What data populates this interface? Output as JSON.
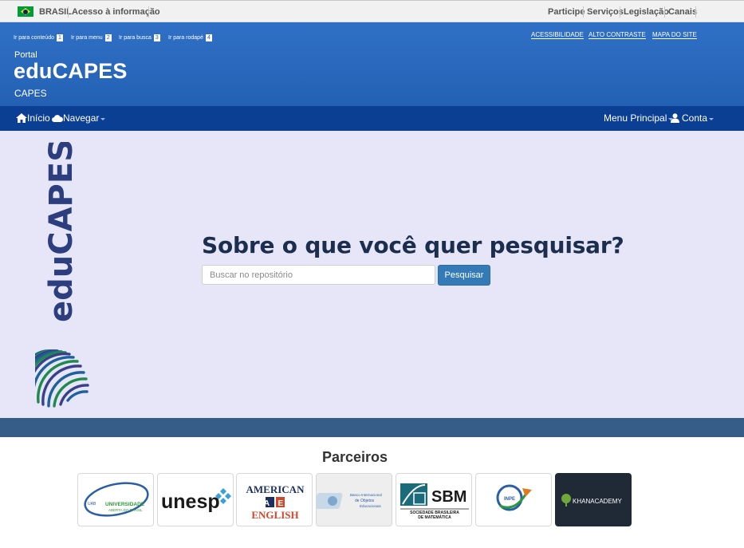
{
  "gov_bar": {
    "country": "BRASIL",
    "access_info": "Acesso à informação",
    "links": [
      "Participe",
      "Serviços",
      "Legislação",
      "Canais"
    ]
  },
  "header": {
    "skip_links": [
      {
        "label": "Ir para conteúdo",
        "num": "1"
      },
      {
        "label": "Ir para menu",
        "num": "2"
      },
      {
        "label": "Ir para busca",
        "num": "3"
      },
      {
        "label": "Ir para rodapé",
        "num": "4"
      }
    ],
    "accessibility_links": [
      "ACESSIBILIDADE",
      "ALTO CONTRASTE",
      "MAPA DO SITE"
    ],
    "portal_label": "Portal",
    "title": "eduCAPES",
    "subtitle": "CAPES"
  },
  "navbar": {
    "home": "Início",
    "browse": "Navegar",
    "main_menu": "Menu Principal",
    "account": "Conta"
  },
  "hero": {
    "logo_text": "eduCAPES",
    "question": "Sobre o que você quer pesquisar?",
    "search_placeholder": "Buscar no repositório",
    "search_button": "Pesquisar"
  },
  "partners": {
    "title": "Parceiros",
    "logos": [
      {
        "lines": [
          "UNIVERSIDADE",
          "ABERTA DO BRASIL"
        ],
        "prefix": "UAB"
      },
      {
        "text": "unesp"
      },
      {
        "lines": [
          "AMERICAN",
          "A E",
          "ENGLISH"
        ]
      },
      {
        "lines": [
          "Banco Internacional",
          "de Objetos",
          "Educacionais"
        ]
      },
      {
        "abbr": "SBM",
        "lines": [
          "SOCIEDADE BRASILEIRA",
          "DE MATEMÁTICA"
        ]
      },
      {
        "text": "INPE"
      },
      {
        "text": "KHANACADEMY"
      }
    ]
  },
  "colors": {
    "header_blue": "#2461b4",
    "navbar_blue": "#0b3f94",
    "hero_bg": "#e6e6f8",
    "band": "#365c88",
    "button": "#337ab7"
  }
}
